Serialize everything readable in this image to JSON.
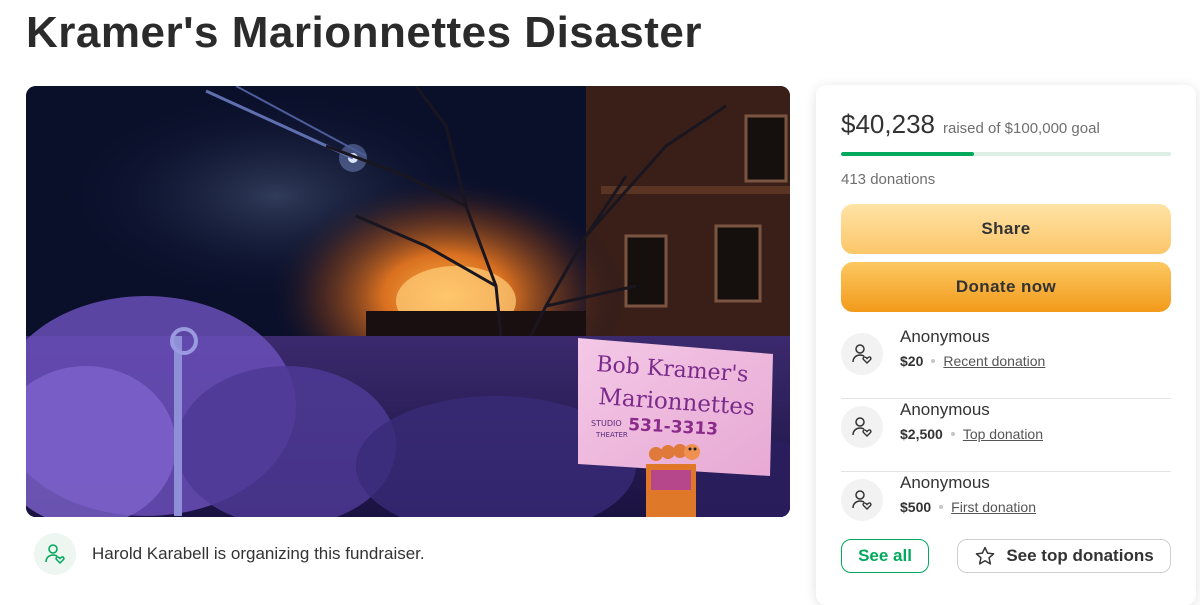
{
  "page": {
    "title": "Kramer's Marionnettes Disaster"
  },
  "hero_image": {
    "sign_line1": "Bob Kramer's",
    "sign_line2": "Marionnettes",
    "sign_studio": "STUDIO",
    "sign_theater": "THEATER",
    "sign_phone": "531-3313"
  },
  "organizer": {
    "text": "Harold Karabell is organizing this fundraiser.",
    "icon": "person-heart-icon"
  },
  "summary": {
    "raised_amount": "$40,238",
    "raised_goal_text": "raised of $100,000 goal",
    "progress_fraction": 0.402,
    "donation_count_text": "413 donations"
  },
  "buttons": {
    "share_label": "Share",
    "donate_label": "Donate now",
    "see_all_label": "See all",
    "see_top_label": "See top donations",
    "see_top_icon": "star-icon"
  },
  "donations": [
    {
      "name": "Anonymous",
      "amount": "$20",
      "tag": "Recent donation"
    },
    {
      "name": "Anonymous",
      "amount": "$2,500",
      "tag": "Top donation"
    },
    {
      "name": "Anonymous",
      "amount": "$500",
      "tag": "First donation"
    }
  ],
  "colors": {
    "accent_green": "#02a95c",
    "share_gradient": [
      "#ffe3a6",
      "#fbc669"
    ],
    "donate_gradient": [
      "#fcc861",
      "#f29a1a"
    ]
  }
}
